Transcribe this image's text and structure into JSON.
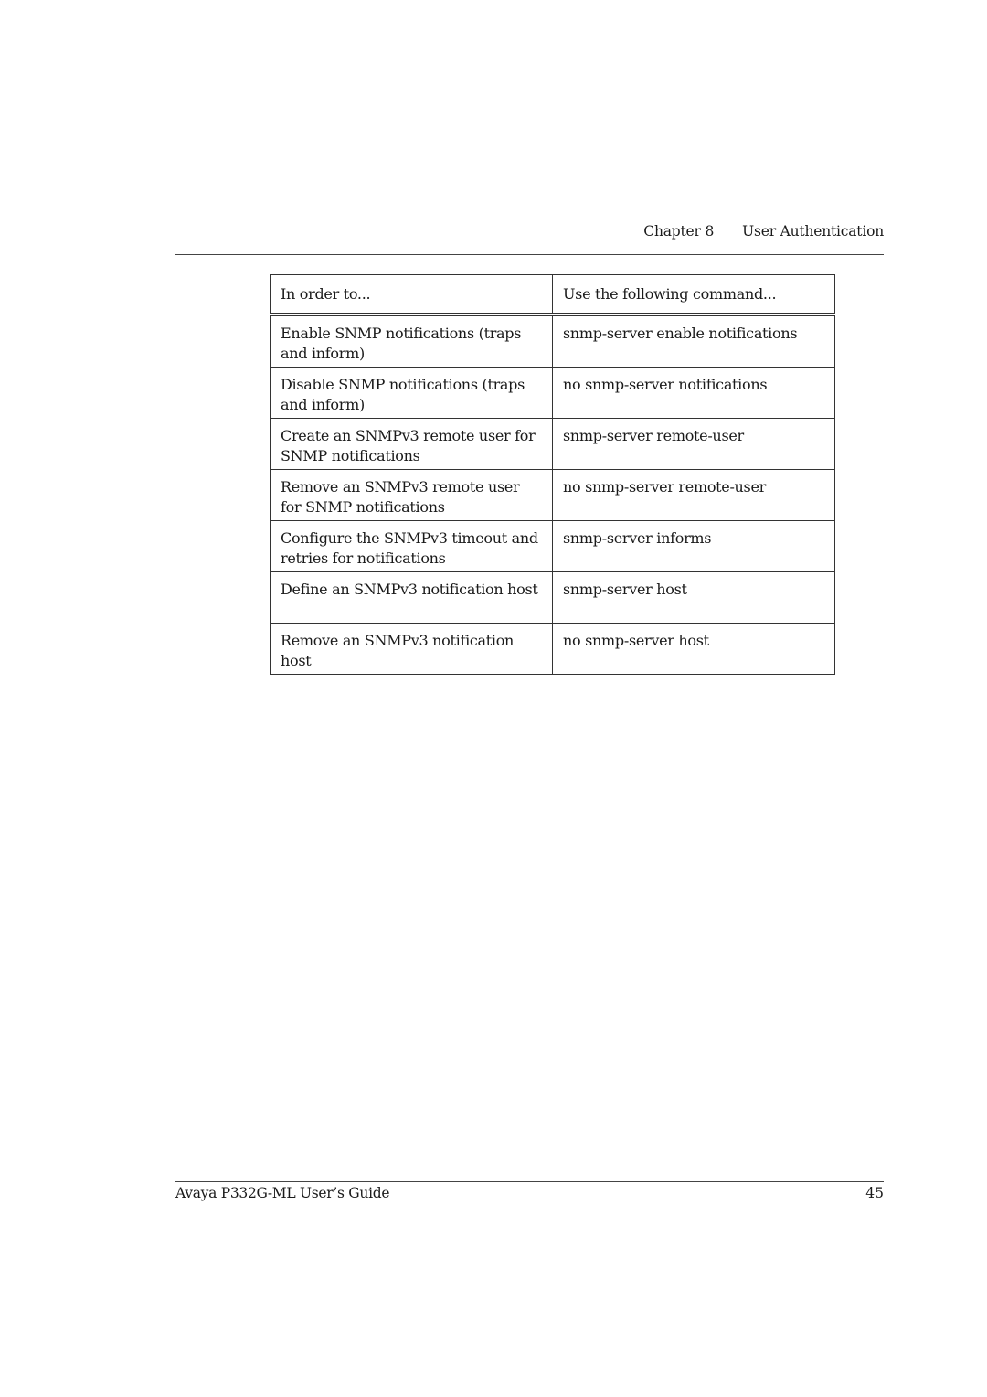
{
  "header": {
    "chapter": "Chapter 8",
    "section": "User Authentication"
  },
  "table": {
    "columns": [
      "In order to...",
      "Use the following command..."
    ],
    "rows": [
      {
        "task": "Enable SNMP notifications (traps and inform)",
        "command": "snmp-server enable notifications"
      },
      {
        "task": "Disable SNMP notifications (traps and inform)",
        "command": "no snmp-server notifications"
      },
      {
        "task": "Create an SNMPv3 remote user for SNMP notifications",
        "command": "snmp-server remote-user"
      },
      {
        "task": "Remove an SNMPv3 remote user for SNMP notifications",
        "command": "no snmp-server remote-user"
      },
      {
        "task": "Configure the SNMPv3 timeout and retries for notifications",
        "command": "snmp-server informs"
      },
      {
        "task": "Define an SNMPv3 notification host",
        "command": "snmp-server host"
      },
      {
        "task": "Remove an SNMPv3 notification host",
        "command": "no snmp-server host"
      }
    ]
  },
  "footer": {
    "title": "Avaya P332G-ML User’s Guide",
    "page_number": "45"
  }
}
